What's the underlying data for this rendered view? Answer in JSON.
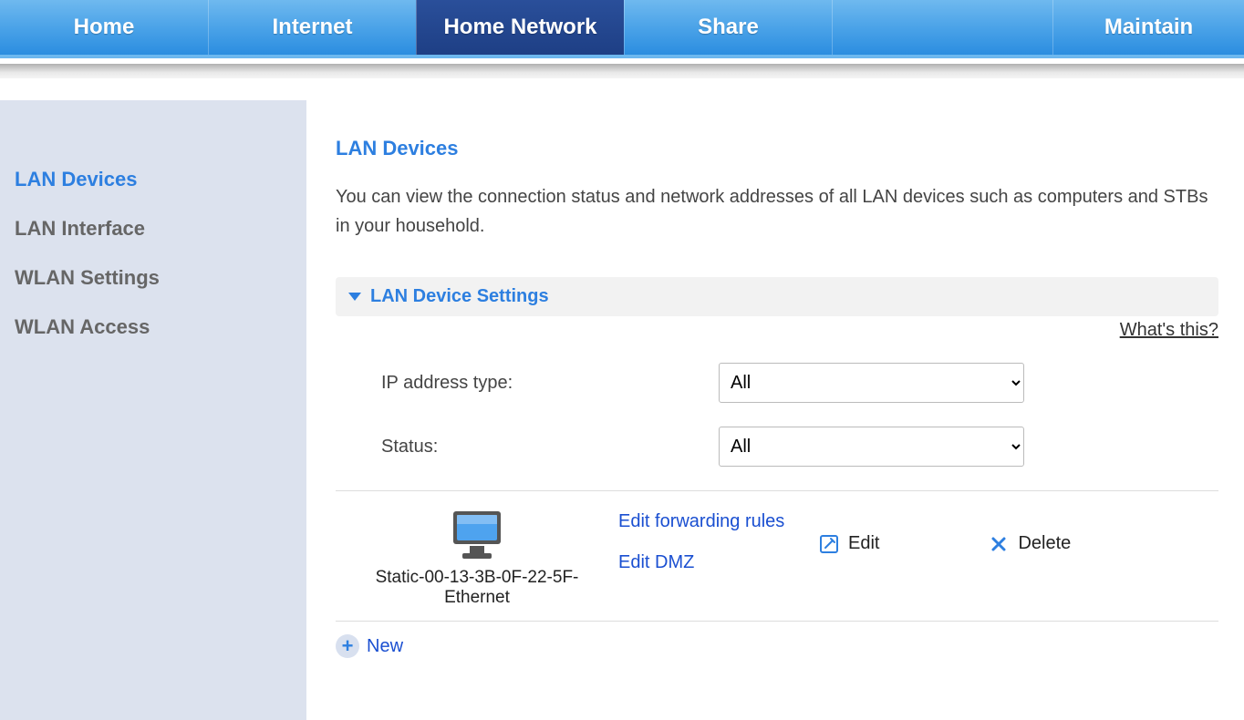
{
  "topnav": {
    "items": [
      {
        "label": "Home"
      },
      {
        "label": "Internet"
      },
      {
        "label": "Home Network",
        "active": true
      },
      {
        "label": "Share"
      }
    ],
    "right": {
      "label": "Maintain"
    }
  },
  "sidebar": {
    "items": [
      {
        "label": "LAN Devices",
        "active": true
      },
      {
        "label": "LAN Interface"
      },
      {
        "label": "WLAN Settings"
      },
      {
        "label": "WLAN Access"
      }
    ]
  },
  "main": {
    "title": "LAN Devices",
    "description": "You can view the connection status and network addresses of all LAN devices such as computers and STBs in your household.",
    "section_title": "LAN Device Settings",
    "whats_this": "What's this?",
    "filters": {
      "ip_type_label": "IP address type:",
      "ip_type_value": "All",
      "status_label": "Status:",
      "status_value": "All"
    },
    "device": {
      "name": "Static-00-13-3B-0F-22-5F-Ethernet",
      "edit_forwarding": "Edit forwarding rules",
      "edit_dmz": "Edit DMZ",
      "edit_label": "Edit",
      "delete_label": "Delete"
    },
    "new_label": "New"
  },
  "icons": {
    "edit": "edit-icon",
    "delete": "close-icon",
    "plus": "plus-icon",
    "monitor": "monitor-icon",
    "chevron_down": "chevron-down-icon"
  }
}
